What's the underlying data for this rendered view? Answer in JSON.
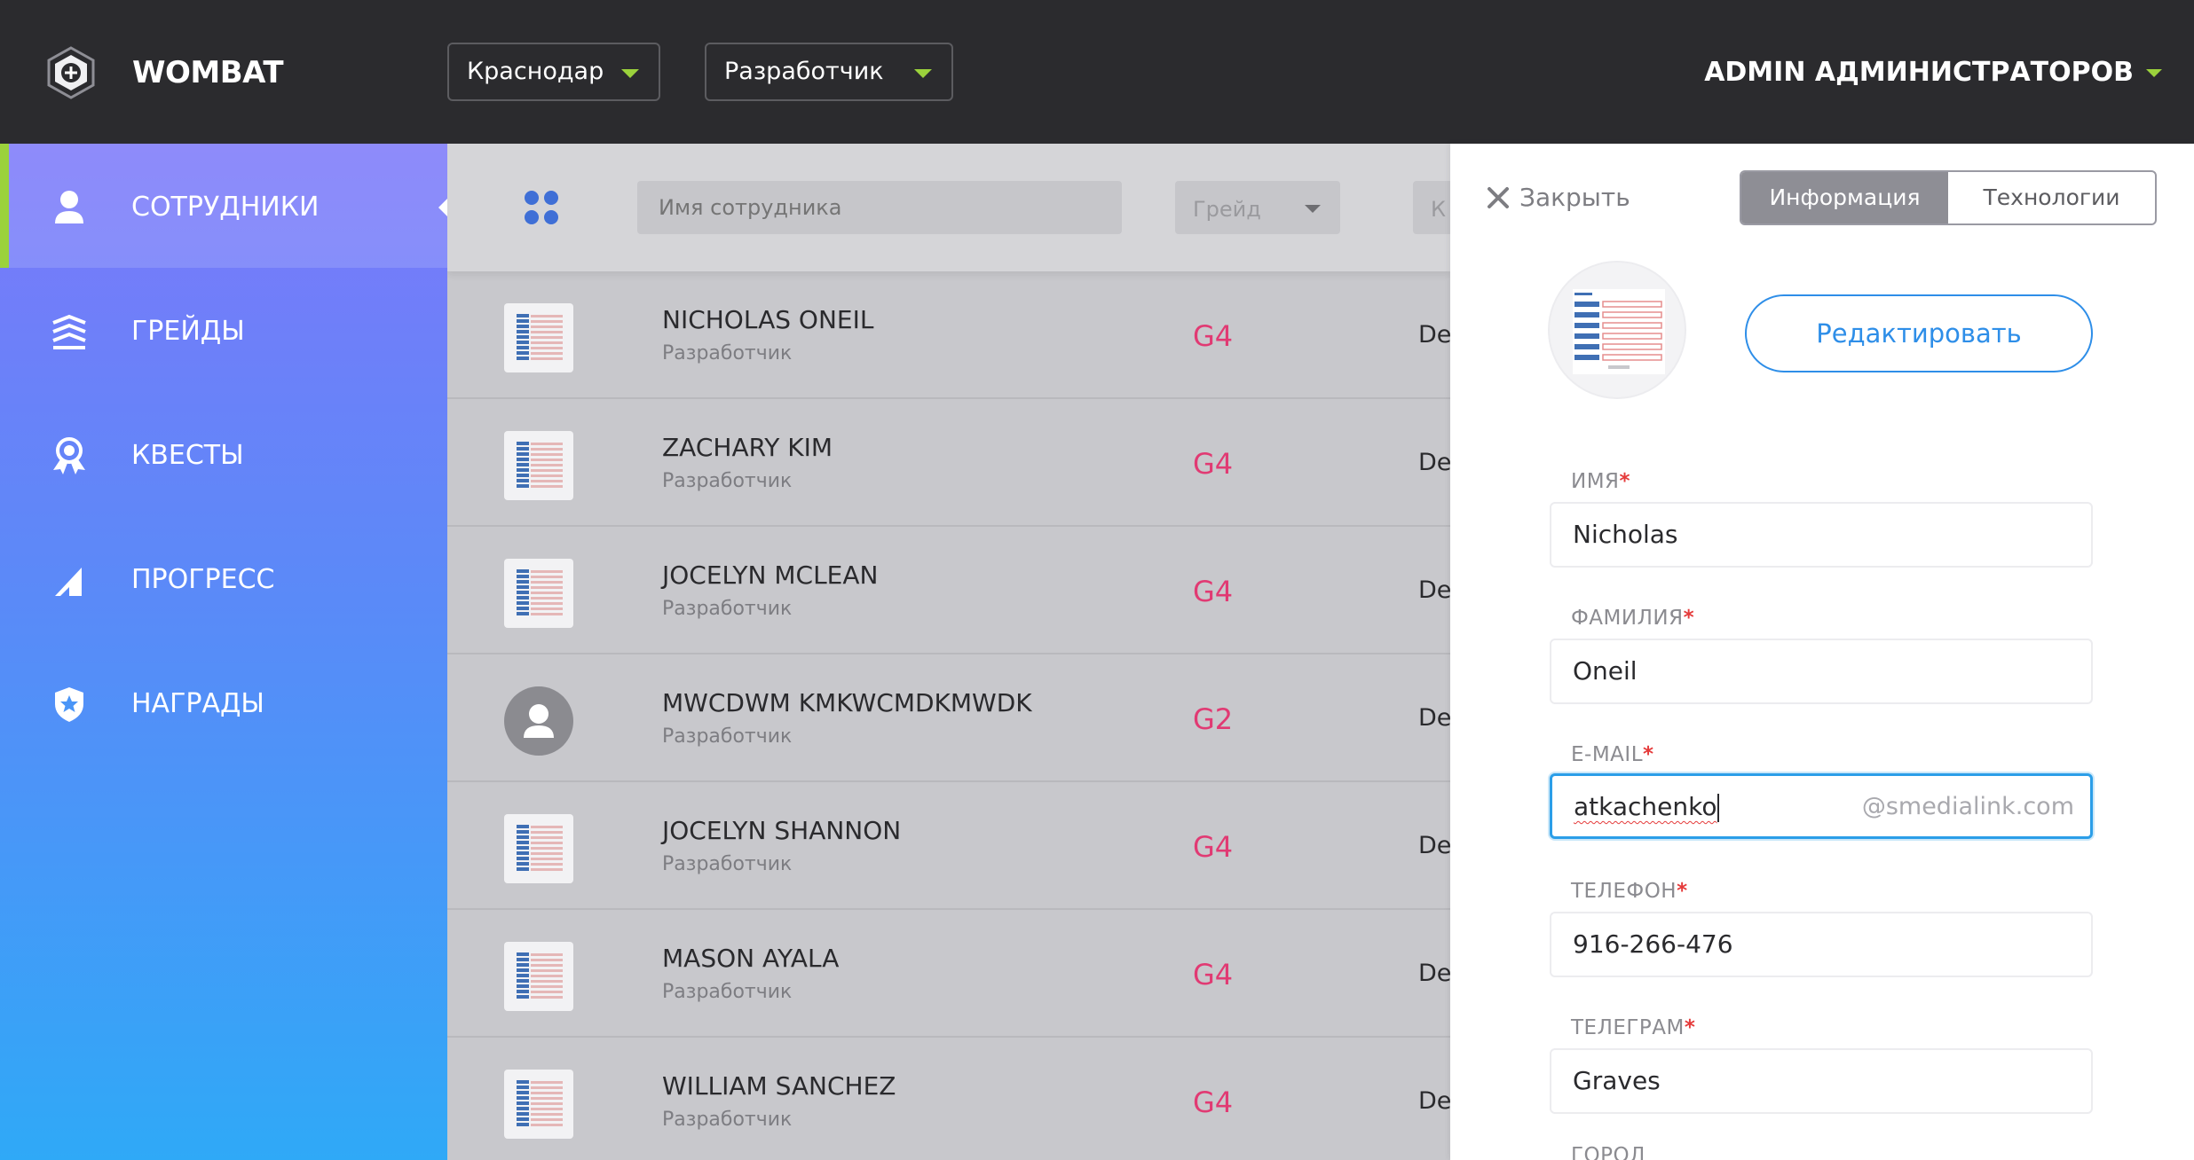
{
  "header": {
    "brand": "WOMBAT",
    "city_select": "Краснодар",
    "role_select": "Разработчик",
    "user": "ADMIN АДМИНИСТРАТОРОВ",
    "accent_color": "#9bd23c"
  },
  "sidebar": {
    "items": [
      {
        "label": "СОТРУДНИКИ",
        "icon": "user-icon",
        "active": true
      },
      {
        "label": "ГРЕЙДЫ",
        "icon": "layers-icon",
        "active": false
      },
      {
        "label": "КВЕСТЫ",
        "icon": "award-icon",
        "active": false
      },
      {
        "label": "ПРОГРЕСС",
        "icon": "signal-icon",
        "active": false
      },
      {
        "label": "НАГРАДЫ",
        "icon": "shield-star-icon",
        "active": false
      }
    ]
  },
  "filters": {
    "search_placeholder": "Имя сотрудника",
    "grade_placeholder": "Грейд",
    "extra_placeholder": "К"
  },
  "employees": [
    {
      "name": "NICHOLAS ONEIL",
      "role": "Разработчик",
      "grade": "G4",
      "dept": "De",
      "avatar": "document"
    },
    {
      "name": "ZACHARY KIM",
      "role": "Разработчик",
      "grade": "G4",
      "dept": "De",
      "avatar": "document"
    },
    {
      "name": "JOCELYN MCLEAN",
      "role": "Разработчик",
      "grade": "G4",
      "dept": "De",
      "avatar": "document"
    },
    {
      "name": "MWCDWM KMKWCMDKMWDK",
      "role": "Разработчик",
      "grade": "G2",
      "dept": "De",
      "avatar": "placeholder"
    },
    {
      "name": "JOCELYN SHANNON",
      "role": "Разработчик",
      "grade": "G4",
      "dept": "De",
      "avatar": "document"
    },
    {
      "name": "MASON AYALA",
      "role": "Разработчик",
      "grade": "G4",
      "dept": "De",
      "avatar": "document"
    },
    {
      "name": "WILLIAM SANCHEZ",
      "role": "Разработчик",
      "grade": "G4",
      "dept": "De",
      "avatar": "document"
    }
  ],
  "panel": {
    "close_label": "Закрыть",
    "tabs": [
      {
        "label": "Информация",
        "active": true
      },
      {
        "label": "Технологии",
        "active": false
      }
    ],
    "edit_button": "Редактировать",
    "required_mark": "*",
    "fields": {
      "first_name": {
        "label": "ИМЯ",
        "value": "Nicholas"
      },
      "last_name": {
        "label": "ФАМИЛИЯ",
        "value": "Oneil"
      },
      "email": {
        "label": "E-MAIL",
        "value": "atkachenko",
        "suffix": "@smedialink.com"
      },
      "phone": {
        "label": "ТЕЛЕФОН",
        "value": "916-266-476"
      },
      "telegram": {
        "label": "ТЕЛЕГРАМ",
        "value": "Graves"
      },
      "city": {
        "label": "ГОРОД"
      }
    }
  },
  "colors": {
    "grade": "#e13a73",
    "primary": "#2e8ee8",
    "required": "#e53b3b"
  }
}
